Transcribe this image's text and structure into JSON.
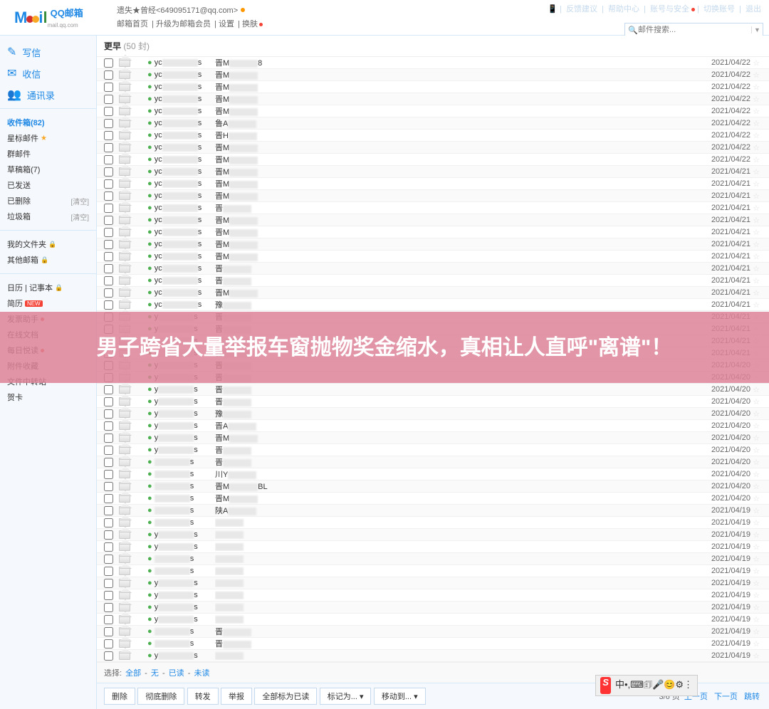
{
  "header": {
    "brand": "QQ邮箱",
    "brand_sub": "mail.qq.com",
    "account": "遗失★曾经<649095171@qq.com>",
    "nav_links": [
      "邮箱首页",
      "升级为邮箱会员",
      "设置",
      "换肤"
    ],
    "top_links": [
      "反馈建议",
      "帮助中心",
      "账号与安全",
      "切换账号",
      "退出"
    ],
    "search_placeholder": "邮件搜索..."
  },
  "sidebar": {
    "actions": [
      {
        "icon": "✎",
        "label": "写信"
      },
      {
        "icon": "✉",
        "label": "收信"
      },
      {
        "icon": "👥",
        "label": "通讯录"
      }
    ],
    "folders": [
      {
        "label": "收件箱(82)",
        "bold": true
      },
      {
        "label": "星标邮件",
        "star": true
      },
      {
        "label": "群邮件"
      },
      {
        "label": "草稿箱(7)"
      },
      {
        "label": "已发送"
      },
      {
        "label": "已删除",
        "clear": "[清空]"
      },
      {
        "label": "垃圾箱",
        "clear": "[清空]"
      }
    ],
    "folders2": [
      {
        "label": "我的文件夹",
        "lock": true
      },
      {
        "label": "其他邮箱",
        "lock": true
      }
    ],
    "folders3": [
      {
        "label": "日历 | 记事本",
        "lock": true
      },
      {
        "label": "简历",
        "new": true
      },
      {
        "label": "发票助手",
        "dot": true
      },
      {
        "label": "在线文档"
      },
      {
        "label": "每日悦读",
        "dot": true
      },
      {
        "label": "附件收藏"
      },
      {
        "label": "文件中转站"
      },
      {
        "label": "贺卡"
      }
    ]
  },
  "mailbox": {
    "group_title": "更早",
    "group_count": "(50 封)",
    "rows": [
      {
        "sender": "yc",
        "subject": "晋M",
        "subject_extra": "8",
        "date": "2021/04/22"
      },
      {
        "sender": "yc",
        "subject": "晋M",
        "date": "2021/04/22"
      },
      {
        "sender": "yc",
        "subject": "晋M",
        "date": "2021/04/22"
      },
      {
        "sender": "yc",
        "subject": "晋M",
        "date": "2021/04/22"
      },
      {
        "sender": "yc",
        "subject": "晋M",
        "date": "2021/04/22"
      },
      {
        "sender": "yc",
        "subject": "鲁A",
        "date": "2021/04/22"
      },
      {
        "sender": "yc",
        "subject": "晋H",
        "date": "2021/04/22"
      },
      {
        "sender": "yc",
        "subject": "晋M",
        "date": "2021/04/22"
      },
      {
        "sender": "yc",
        "subject": "晋M",
        "date": "2021/04/22"
      },
      {
        "sender": "yc",
        "subject": "晋M",
        "date": "2021/04/21"
      },
      {
        "sender": "yc",
        "subject": "晋M",
        "date": "2021/04/21"
      },
      {
        "sender": "yc",
        "subject": "晋M",
        "date": "2021/04/21"
      },
      {
        "sender": "yc",
        "subject": "晋",
        "date": "2021/04/21"
      },
      {
        "sender": "yc",
        "subject": "晋M",
        "date": "2021/04/21"
      },
      {
        "sender": "yc",
        "subject": "晋M",
        "date": "2021/04/21"
      },
      {
        "sender": "yc",
        "subject": "晋M",
        "date": "2021/04/21"
      },
      {
        "sender": "yc",
        "subject": "晋M",
        "date": "2021/04/21"
      },
      {
        "sender": "yc",
        "subject": "晋",
        "date": "2021/04/21"
      },
      {
        "sender": "yc",
        "subject": "晋",
        "date": "2021/04/21"
      },
      {
        "sender": "yc",
        "subject": "晋M",
        "date": "2021/04/21"
      },
      {
        "sender": "yc",
        "subject": "豫",
        "date": "2021/04/21"
      },
      {
        "sender": "y",
        "subject": "晋",
        "date": "2021/04/21"
      },
      {
        "sender": "y",
        "subject": "晋",
        "date": "2021/04/21"
      },
      {
        "sender": "y",
        "subject": "晋",
        "date": "2021/04/21"
      },
      {
        "sender": "y",
        "subject": "晋",
        "date": "2021/04/21"
      },
      {
        "sender": "y",
        "subject": "晋",
        "date": "2021/04/20"
      },
      {
        "sender": "y",
        "subject": "晋",
        "date": "2021/04/20"
      },
      {
        "sender": "y",
        "subject": "晋",
        "date": "2021/04/20"
      },
      {
        "sender": "y",
        "subject": "晋",
        "date": "2021/04/20"
      },
      {
        "sender": "y",
        "subject": "豫",
        "date": "2021/04/20"
      },
      {
        "sender": "y",
        "subject": "晋A",
        "date": "2021/04/20"
      },
      {
        "sender": "y",
        "subject": "晋M",
        "date": "2021/04/20"
      },
      {
        "sender": "y",
        "subject": "晋",
        "date": "2021/04/20"
      },
      {
        "sender": "",
        "subject": "晋",
        "date": "2021/04/20"
      },
      {
        "sender": "",
        "subject": "川Y",
        "date": "2021/04/20"
      },
      {
        "sender": "",
        "subject": "晋M",
        "subject_extra": "BL",
        "date": "2021/04/20"
      },
      {
        "sender": "",
        "subject": "晋M",
        "date": "2021/04/20"
      },
      {
        "sender": "",
        "subject": "陕A",
        "date": "2021/04/19"
      },
      {
        "sender": "",
        "subject": "",
        "date": "2021/04/19"
      },
      {
        "sender": "y",
        "subject": "",
        "date": "2021/04/19"
      },
      {
        "sender": "y",
        "subject": "",
        "date": "2021/04/19"
      },
      {
        "sender": "",
        "subject": "",
        "date": "2021/04/19"
      },
      {
        "sender": "",
        "subject": "",
        "date": "2021/04/19"
      },
      {
        "sender": "y",
        "subject": "",
        "date": "2021/04/19"
      },
      {
        "sender": "y",
        "subject": "",
        "date": "2021/04/19"
      },
      {
        "sender": "y",
        "subject": "",
        "date": "2021/04/19"
      },
      {
        "sender": "y",
        "subject": "",
        "date": "2021/04/19"
      },
      {
        "sender": "",
        "subject": "晋",
        "date": "2021/04/19"
      },
      {
        "sender": "",
        "subject": "晋",
        "date": "2021/04/19"
      },
      {
        "sender": "y",
        "subject": "",
        "date": "2021/04/19"
      }
    ]
  },
  "footer": {
    "select_label": "选择:",
    "select_options": [
      "全部",
      "无",
      "已读",
      "未读"
    ],
    "buttons": [
      "删除",
      "彻底删除",
      "转发",
      "举报",
      "全部标为已读",
      "标记为...",
      "移动到..."
    ],
    "page_info": "3/6 页",
    "page_links": [
      "上一页",
      "下一页",
      "跳转"
    ]
  },
  "overlay": {
    "text": "男子跨省大量举报车窗抛物奖金缩水，真相让人直呼\"离谱\"！"
  },
  "ime": {
    "items": [
      "中",
      "•,",
      "⌨",
      "🗊",
      "🎤",
      "😊",
      "⚙",
      "⋮"
    ]
  }
}
